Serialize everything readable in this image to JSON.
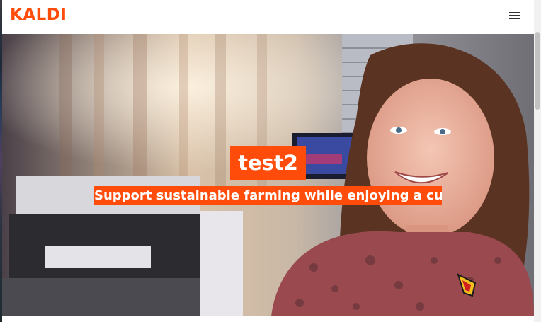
{
  "header": {
    "logo_text": "KALDI",
    "menu_icon": "hamburger-menu-icon"
  },
  "hero": {
    "title": "test2",
    "subtitle": "Support sustainable farming while enjoying a cup",
    "image_description_icon": "hero-photo"
  },
  "colors": {
    "accent": "#ff4c0b",
    "text_on_accent": "#ffffff",
    "navbar_background": "#ffffff"
  }
}
